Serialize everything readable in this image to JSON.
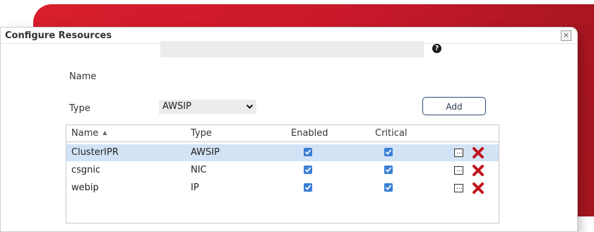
{
  "dialog": {
    "title": "Configure Resources",
    "close_glyph": "×"
  },
  "form": {
    "name_label": "Name",
    "name_value": "",
    "help_glyph": "?",
    "type_label": "Type",
    "type_selected": "AWSIP",
    "add_label": "Add"
  },
  "grid": {
    "columns": {
      "name": "Name",
      "sort_indicator": "▲",
      "type": "Type",
      "enabled": "Enabled",
      "critical": "Critical"
    },
    "rows": [
      {
        "name": "ClusterIPR",
        "type": "AWSIP",
        "enabled": true,
        "critical": true,
        "selected": true
      },
      {
        "name": "csgnic",
        "type": "NIC",
        "enabled": true,
        "critical": true,
        "selected": false
      },
      {
        "name": "webip",
        "type": "IP",
        "enabled": true,
        "critical": true,
        "selected": false
      }
    ]
  },
  "colors": {
    "accent_red": "#d81e2c",
    "checkbox_blue": "#3a7fd6",
    "row_selected": "#d3e3f6",
    "delete_red": "#c0141c"
  },
  "icons": {
    "help": "question-circle-icon",
    "dropdown": "chevron-down-icon",
    "edit": "ellipsis-box-icon",
    "delete": "red-x-icon",
    "check": "checkmark-icon"
  }
}
